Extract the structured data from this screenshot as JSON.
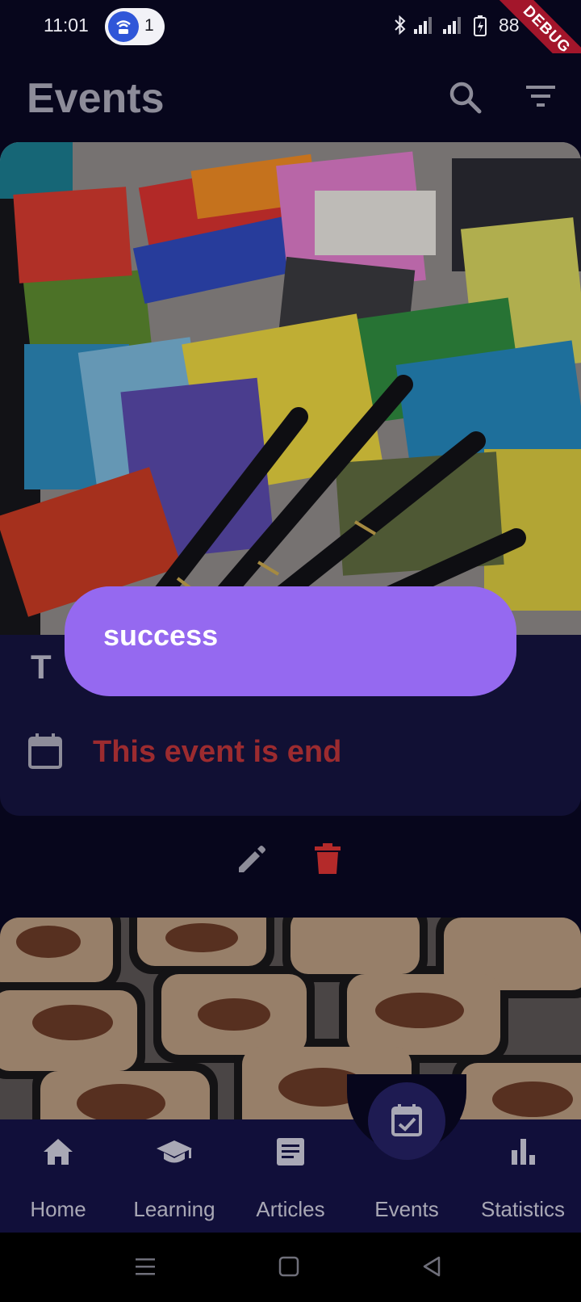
{
  "status_bar": {
    "time": "11:01",
    "hotspot_count": "1",
    "battery": "88",
    "debug_banner": "DEBUG"
  },
  "app_bar": {
    "title": "Events",
    "icons": [
      "search-icon",
      "filter-icon"
    ]
  },
  "events": [
    {
      "image": "stationery-notebooks-pens-photo",
      "title_icon": "T",
      "date_status": "This event is end",
      "actions": [
        "edit-icon",
        "delete-icon"
      ]
    },
    {
      "image": "food-containers-photo"
    }
  ],
  "snackbar": {
    "message": "success"
  },
  "bottom_nav": {
    "items": [
      {
        "label": "Home",
        "icon": "home-icon"
      },
      {
        "label": "Learning",
        "icon": "school-icon"
      },
      {
        "label": "Articles",
        "icon": "article-icon"
      },
      {
        "label": "Events",
        "icon": "event-check-icon",
        "active": true
      },
      {
        "label": "Statistics",
        "icon": "bar-chart-icon"
      }
    ]
  },
  "colors": {
    "background": "#07061c",
    "card": "#111034",
    "snackbar": "#9569f0",
    "ended_text": "#9c2b2f",
    "delete": "#b42a2a"
  }
}
